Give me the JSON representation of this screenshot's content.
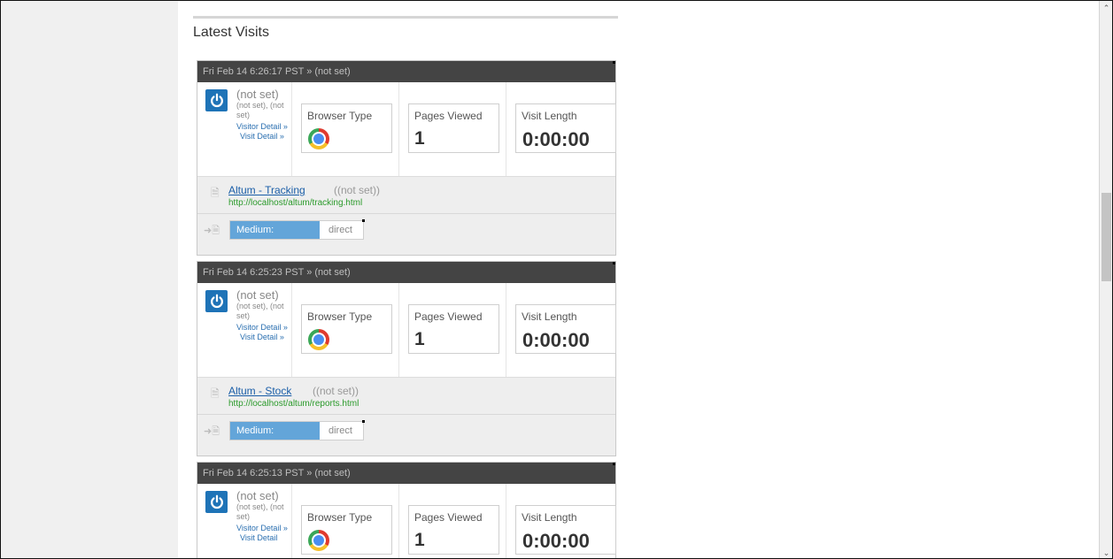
{
  "section_title": "Latest Visits",
  "labels": {
    "browser_type": "Browser Type",
    "pages_viewed": "Pages Viewed",
    "visit_length": "Visit Length",
    "medium": "Medium:"
  },
  "visits": [
    {
      "header": "Fri Feb 14 6:26:17 PST » (not set)",
      "visitor_name": "(not set)",
      "visitor_location": "(not set), (not set)",
      "visitor_detail_link": "Visitor Detail »",
      "visit_detail_link": "Visit Detail »",
      "browser_icon": "chrome-icon",
      "pages_viewed": "1",
      "visit_length": "0:00:00",
      "page_title": "Altum - Tracking",
      "page_set": "((not set))",
      "page_url": "http://localhost/altum/tracking.html",
      "medium_value": "direct"
    },
    {
      "header": "Fri Feb 14 6:25:23 PST » (not set)",
      "visitor_name": "(not set)",
      "visitor_location": "(not set), (not set)",
      "visitor_detail_link": "Visitor Detail »",
      "visit_detail_link": "Visit Detail »",
      "browser_icon": "chrome-icon",
      "pages_viewed": "1",
      "visit_length": "0:00:00",
      "page_title": "Altum - Stock",
      "page_set": "((not set))",
      "page_url": "http://localhost/altum/reports.html",
      "medium_value": "direct"
    },
    {
      "header": "Fri Feb 14 6:25:13 PST » (not set)",
      "visitor_name": "(not set)",
      "visitor_location": "(not set), (not set)",
      "visitor_detail_link": "Visitor Detail »",
      "visit_detail_link": "Visit Detail",
      "browser_icon": "chrome-icon",
      "pages_viewed": "1",
      "visit_length": "0:00:00"
    }
  ],
  "colors": {
    "header_bg": "#444444",
    "power_icon_bg": "#1e73b7",
    "medium_label_bg": "#63a5d9",
    "url_green": "#2b9a2b",
    "link_blue": "#1a5ea8"
  }
}
